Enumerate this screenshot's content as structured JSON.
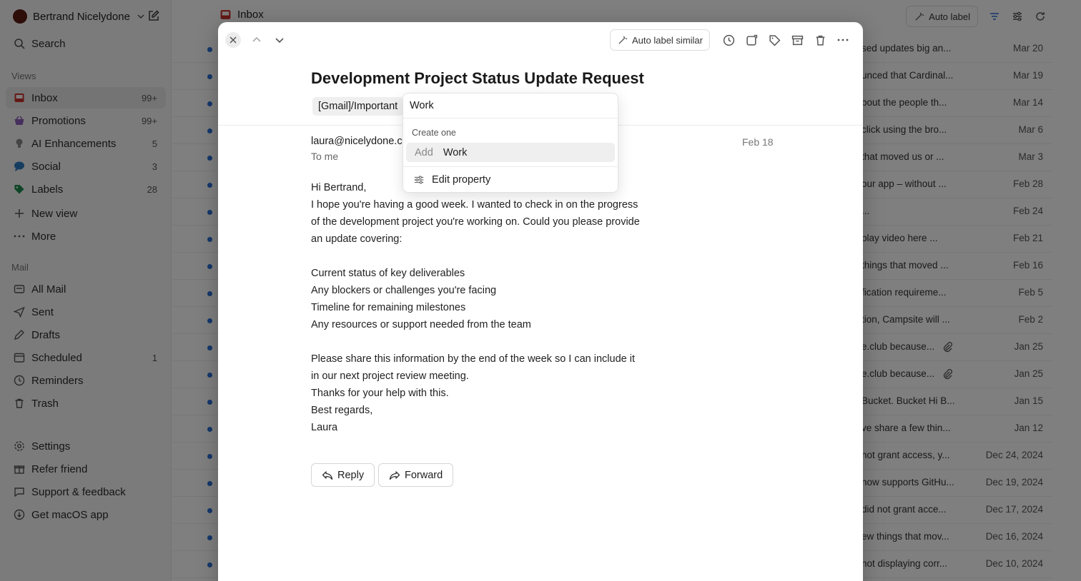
{
  "account": {
    "name": "Bertrand Nicelydone"
  },
  "sidebar": {
    "search_label": "Search",
    "views_heading": "Views",
    "views": [
      {
        "label": "Inbox",
        "count": "99+",
        "icon": "inbox-icon"
      },
      {
        "label": "Promotions",
        "count": "99+",
        "icon": "basket-icon"
      },
      {
        "label": "AI Enhancements",
        "count": "5",
        "icon": "bulb-icon"
      },
      {
        "label": "Social",
        "count": "3",
        "icon": "chat-bubble-icon"
      },
      {
        "label": "Labels",
        "count": "28",
        "icon": "tag-icon"
      }
    ],
    "new_view_label": "New view",
    "more_label": "More",
    "mail_heading": "Mail",
    "mail": [
      {
        "label": "All Mail",
        "count": "",
        "icon": "all-mail-icon"
      },
      {
        "label": "Sent",
        "count": "",
        "icon": "send-icon"
      },
      {
        "label": "Drafts",
        "count": "",
        "icon": "draft-icon"
      },
      {
        "label": "Scheduled",
        "count": "1",
        "icon": "calendar-icon"
      },
      {
        "label": "Reminders",
        "count": "",
        "icon": "clock-icon"
      },
      {
        "label": "Trash",
        "count": "",
        "icon": "trash-icon"
      }
    ],
    "footer": [
      {
        "label": "Settings",
        "icon": "gear-icon"
      },
      {
        "label": "Refer friend",
        "icon": "gift-icon"
      },
      {
        "label": "Support & feedback",
        "icon": "feedback-icon"
      },
      {
        "label": "Get macOS app",
        "icon": "download-icon"
      }
    ]
  },
  "list": {
    "title": "Inbox",
    "auto_label": "Auto label",
    "rows": [
      {
        "snippet": "sed updates big an...",
        "date": "Mar 20",
        "attachment": false
      },
      {
        "snippet": "unced that Cardinal...",
        "date": "Mar 19",
        "attachment": false
      },
      {
        "snippet": "bout the people th...",
        "date": "Mar 14",
        "attachment": false
      },
      {
        "snippet": "click using the bro...",
        "date": "Mar 6",
        "attachment": false
      },
      {
        "snippet": "that moved us or ...",
        "date": "Mar 3",
        "attachment": false
      },
      {
        "snippet": "our app – without ...",
        "date": "Feb 28",
        "attachment": false
      },
      {
        "snippet": "...",
        "date": "Feb 24",
        "attachment": false
      },
      {
        "snippet": "play video here ...",
        "date": "Feb 21",
        "attachment": false
      },
      {
        "snippet": "things that moved ...",
        "date": "Feb 16",
        "attachment": false
      },
      {
        "snippet": "fication requireme...",
        "date": "Feb 5",
        "attachment": false
      },
      {
        "snippet": "tion, Campsite will ...",
        "date": "Feb 2",
        "attachment": false
      },
      {
        "snippet": "e.club because...",
        "date": "Jan 25",
        "attachment": true
      },
      {
        "snippet": "e.club because...",
        "date": "Jan 25",
        "attachment": true
      },
      {
        "snippet": "Bucket. Bucket Hi B...",
        "date": "Jan 15",
        "attachment": false
      },
      {
        "snippet": "ve share a few thin...",
        "date": "Jan 12",
        "attachment": false
      },
      {
        "snippet": "not grant access, y...",
        "date": "Dec 24, 2024",
        "attachment": false
      },
      {
        "snippet": "now supports GitHu...",
        "date": "Dec 19, 2024",
        "attachment": false
      },
      {
        "snippet": "did not grant acce...",
        "date": "Dec 17, 2024",
        "attachment": false
      },
      {
        "snippet": "ew things that mov...",
        "date": "Dec 16, 2024",
        "attachment": false
      },
      {
        "snippet": "not displaying corr...",
        "date": "Dec 10, 2024",
        "attachment": false
      }
    ]
  },
  "email": {
    "toolbar_auto_label": "Auto label similar",
    "subject": "Development Project Status Update Request",
    "tag": "[Gmail]/Important",
    "from": "laura@nicelydone.club",
    "to": "To me",
    "date": "Feb 18",
    "body": [
      "Hi Bertrand,",
      "I hope you're having a good week. I wanted to check in on the progress",
      "of the development project you're working on. Could you please provide",
      "an update covering:",
      "",
      "Current status of key deliverables",
      "Any blockers or challenges you're facing",
      "Timeline for remaining milestones",
      "Any resources or support needed from the team",
      "",
      "Please share this information by the end of the week so I can include it",
      "in our next project review meeting.",
      "Thanks for your help with this.",
      "Best regards,",
      "Laura"
    ],
    "reply_label": "Reply",
    "forward_label": "Forward"
  },
  "popover": {
    "input_value": "Work",
    "heading": "Create one",
    "option_prefix": "Add",
    "option_value": "Work",
    "edit_label": "Edit property"
  },
  "colors": {
    "accent": "#2c6fd6",
    "inbox_icon": "#c8302c",
    "overlay": "rgba(0,0,0,0.5)"
  }
}
